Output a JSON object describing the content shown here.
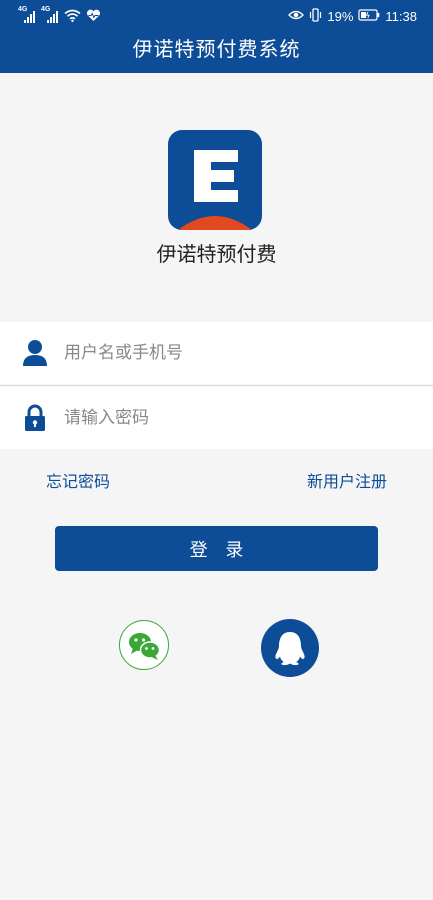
{
  "status_bar": {
    "signal_1_tag": "4G",
    "signal_2_tag": "4G",
    "battery_percent": "19%",
    "time": "11:38"
  },
  "header": {
    "title": "伊诺特预付费系统"
  },
  "brand": {
    "name": "伊诺特预付费",
    "logo_letter": "E"
  },
  "form": {
    "username_placeholder": "用户名或手机号",
    "password_placeholder": "请输入密码",
    "username_value": "",
    "password_value": ""
  },
  "links": {
    "forgot_password": "忘记密码",
    "register": "新用户注册"
  },
  "login_button_label": "登 录",
  "social": {
    "wechat_icon": "wechat-icon",
    "qq_icon": "qq-icon"
  },
  "colors": {
    "primary": "#0d4c97",
    "accent_orange": "#e2491f",
    "wechat_green": "#3aa836"
  }
}
